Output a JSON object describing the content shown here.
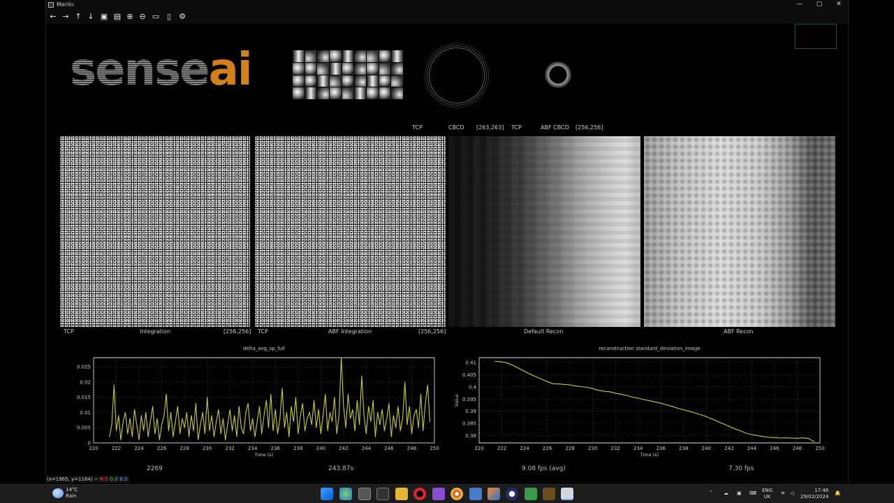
{
  "window": {
    "title": "Merlin",
    "minimize": "—",
    "maximize": "▢",
    "close": "✕"
  },
  "toolbar": [
    {
      "icon": "back-arrow-icon",
      "glyph": "←"
    },
    {
      "icon": "forward-arrow-icon",
      "glyph": "→"
    },
    {
      "icon": "up-arrow-icon",
      "glyph": "↑"
    },
    {
      "icon": "down-arrow-icon",
      "glyph": "↓"
    },
    {
      "icon": "image-icon",
      "glyph": "▣"
    },
    {
      "icon": "image-export-icon",
      "glyph": "▤"
    },
    {
      "icon": "zoom-in-icon",
      "glyph": "⊕"
    },
    {
      "icon": "zoom-out-icon",
      "glyph": "⊖"
    },
    {
      "icon": "save-icon",
      "glyph": "▭"
    },
    {
      "icon": "clipboard-icon",
      "glyph": "▯"
    },
    {
      "icon": "settings-icon",
      "glyph": "⚙"
    }
  ],
  "logo": {
    "part1": "sense",
    "part2": "ai"
  },
  "ring_captions": {
    "cbed_tag": "TCP",
    "cbed_label": "CBCD",
    "cbed_size": "[263,263]",
    "abf_tag": "TCP",
    "abf_label": "ABF CBCD",
    "abf_size": "[256,256]"
  },
  "panels": {
    "p1_tag": "TCP",
    "p1_label": "Integration",
    "p1_size": "[256,256]",
    "p2_tag": "TCP",
    "p2_label": "ABF Integration",
    "p2_size": "[256,256]",
    "p3_label": "Default Recon",
    "p4_label": "ABF Recon"
  },
  "stats": {
    "frame": "2269",
    "elapsed": "243.87s",
    "fps_avg": "9.08 fps (avg)",
    "fps": "7.30 fps"
  },
  "coord_readout": {
    "pos": "(x=1965, y=1164) ~",
    "r": "R:0",
    "g": "G:0",
    "b": "B:0"
  },
  "taskbar": {
    "temp": "14°C",
    "weather": "Rain",
    "lang1": "ENG",
    "lang2": "UK",
    "time": "17:46",
    "date": "29/02/2024"
  },
  "colors": {
    "plot_line": "#c8cc3c",
    "logo_orange": "#d2801c",
    "logo_gray": "#888888"
  },
  "chart_data": [
    {
      "type": "line",
      "title": "delta_avg_sp_full",
      "xlabel": "Time (s)",
      "ylabel": "",
      "xlim": [
        220,
        250
      ],
      "ylim": [
        0,
        0.028
      ],
      "xticks": [
        "220",
        "222",
        "224",
        "226",
        "228",
        "230",
        "232",
        "234",
        "236",
        "238",
        "240",
        "242",
        "244",
        "246",
        "248",
        "250"
      ],
      "yticks": [
        "0",
        "0.005",
        "0.01",
        "0.015",
        "0.02",
        "0.025"
      ],
      "grid": true,
      "x": [
        221.4,
        221.6,
        221.8,
        222.0,
        222.2,
        222.4,
        222.6,
        222.8,
        223.0,
        223.2,
        223.4,
        223.6,
        223.8,
        224.0,
        224.2,
        224.4,
        224.6,
        224.8,
        225.0,
        225.2,
        225.4,
        225.6,
        225.8,
        226.0,
        226.2,
        226.4,
        226.6,
        226.8,
        227.0,
        227.2,
        227.4,
        227.6,
        227.8,
        228.0,
        228.2,
        228.4,
        228.6,
        228.8,
        229.0,
        229.2,
        229.4,
        229.6,
        229.8,
        230.0,
        230.2,
        230.4,
        230.6,
        230.8,
        231.0,
        231.2,
        231.4,
        231.6,
        231.8,
        232.0,
        232.2,
        232.4,
        232.6,
        232.8,
        233.0,
        233.2,
        233.4,
        233.6,
        233.8,
        234.0,
        234.2,
        234.4,
        234.6,
        234.8,
        235.0,
        235.2,
        235.4,
        235.6,
        235.8,
        236.0,
        236.2,
        236.4,
        236.6,
        236.8,
        237.0,
        237.2,
        237.4,
        237.6,
        237.8,
        238.0,
        238.2,
        238.4,
        238.6,
        238.8,
        239.0,
        239.2,
        239.4,
        239.6,
        239.8,
        240.0,
        240.2,
        240.4,
        240.6,
        240.8,
        241.0,
        241.2,
        241.4,
        241.6,
        241.8,
        242.0,
        242.2,
        242.4,
        242.6,
        242.8,
        243.0,
        243.2,
        243.4,
        243.6,
        243.8,
        244.0,
        244.2,
        244.4,
        244.6,
        244.8,
        245.0,
        245.2,
        245.4,
        245.6,
        245.8,
        246.0,
        246.2,
        246.4,
        246.6,
        246.8,
        247.0,
        247.2,
        247.4,
        247.6,
        247.8,
        248.0,
        248.2,
        248.4,
        248.6,
        248.8,
        249.0,
        249.2,
        249.4,
        249.6
      ],
      "y": [
        0.002,
        0.006,
        0.019,
        0.004,
        0.009,
        0.001,
        0.007,
        0.01,
        0.003,
        0.008,
        0.002,
        0.011,
        0.006,
        0.001,
        0.009,
        0.004,
        0.01,
        0.002,
        0.007,
        0.012,
        0.003,
        0.008,
        0.001,
        0.006,
        0.009,
        0.016,
        0.004,
        0.01,
        0.002,
        0.007,
        0.012,
        0.003,
        0.008,
        0.005,
        0.01,
        0.002,
        0.009,
        0.004,
        0.013,
        0.001,
        0.006,
        0.01,
        0.003,
        0.015,
        0.004,
        0.009,
        0.002,
        0.007,
        0.011,
        0.003,
        0.008,
        0.001,
        0.006,
        0.011,
        0.004,
        0.009,
        0.002,
        0.012,
        0.005,
        0.003,
        0.01,
        0.013,
        0.004,
        0.008,
        0.002,
        0.007,
        0.012,
        0.003,
        0.009,
        0.014,
        0.005,
        0.016,
        0.004,
        0.011,
        0.003,
        0.008,
        0.018,
        0.005,
        0.01,
        0.002,
        0.012,
        0.007,
        0.015,
        0.003,
        0.009,
        0.013,
        0.004,
        0.008,
        0.01,
        0.006,
        0.014,
        0.005,
        0.011,
        0.003,
        0.009,
        0.016,
        0.004,
        0.01,
        0.007,
        0.015,
        0.003,
        0.009,
        0.028,
        0.012,
        0.005,
        0.016,
        0.008,
        0.011,
        0.004,
        0.014,
        0.006,
        0.022,
        0.009,
        0.003,
        0.012,
        0.007,
        0.014,
        0.002,
        0.01,
        0.006,
        0.011,
        0.004,
        0.008,
        0.013,
        0.002,
        0.009,
        0.005,
        0.012,
        0.004,
        0.008,
        0.02,
        0.006,
        0.012,
        0.003,
        0.009,
        0.011,
        0.005,
        0.016,
        0.004,
        0.013,
        0.019,
        0.007,
        0.015,
        0.003,
        0.011,
        0.006,
        0.014,
        0.004,
        0.012,
        0.002
      ]
    },
    {
      "type": "line",
      "title": "reconstruction standard_deviation_image",
      "xlabel": "Time (s)",
      "ylabel": "Value",
      "xlim": [
        220,
        250
      ],
      "ylim": [
        0.377,
        0.412
      ],
      "xticks": [
        "220",
        "222",
        "224",
        "226",
        "228",
        "230",
        "232",
        "234",
        "236",
        "238",
        "240",
        "242",
        "244",
        "246",
        "248",
        "250"
      ],
      "yticks": [
        "0.38",
        "0.385",
        "0.39",
        "0.395",
        "0.4",
        "0.405",
        "0.41"
      ],
      "grid": true,
      "x": [
        221.4,
        222.0,
        222.5,
        223.0,
        223.5,
        224.0,
        224.5,
        225.0,
        225.5,
        226.0,
        226.5,
        227.0,
        227.5,
        228.0,
        228.5,
        229.0,
        229.5,
        230.0,
        230.5,
        231.0,
        231.5,
        232.0,
        232.5,
        233.0,
        233.5,
        234.0,
        234.5,
        235.0,
        235.5,
        236.0,
        236.5,
        237.0,
        237.5,
        238.0,
        238.5,
        239.0,
        239.5,
        240.0,
        240.5,
        241.0,
        241.5,
        242.0,
        242.5,
        243.0,
        243.5,
        244.0,
        244.5,
        245.0,
        245.5,
        246.0,
        246.5,
        247.0,
        247.5,
        248.0,
        248.5,
        249.0,
        249.5
      ],
      "y": [
        0.4105,
        0.4103,
        0.4098,
        0.4088,
        0.4076,
        0.4064,
        0.4052,
        0.4042,
        0.4032,
        0.4022,
        0.4013,
        0.4012,
        0.401,
        0.4008,
        0.4004,
        0.4001,
        0.3998,
        0.3993,
        0.3986,
        0.3982,
        0.398,
        0.3974,
        0.397,
        0.3965,
        0.3958,
        0.3954,
        0.3948,
        0.3943,
        0.3938,
        0.3933,
        0.3926,
        0.392,
        0.3912,
        0.3906,
        0.39,
        0.3893,
        0.3886,
        0.3878,
        0.3868,
        0.3858,
        0.3848,
        0.3838,
        0.3828,
        0.382,
        0.381,
        0.3804,
        0.38,
        0.3796,
        0.3793,
        0.3792,
        0.379,
        0.3791,
        0.379,
        0.3789,
        0.3791,
        0.3788,
        0.3775
      ]
    }
  ]
}
